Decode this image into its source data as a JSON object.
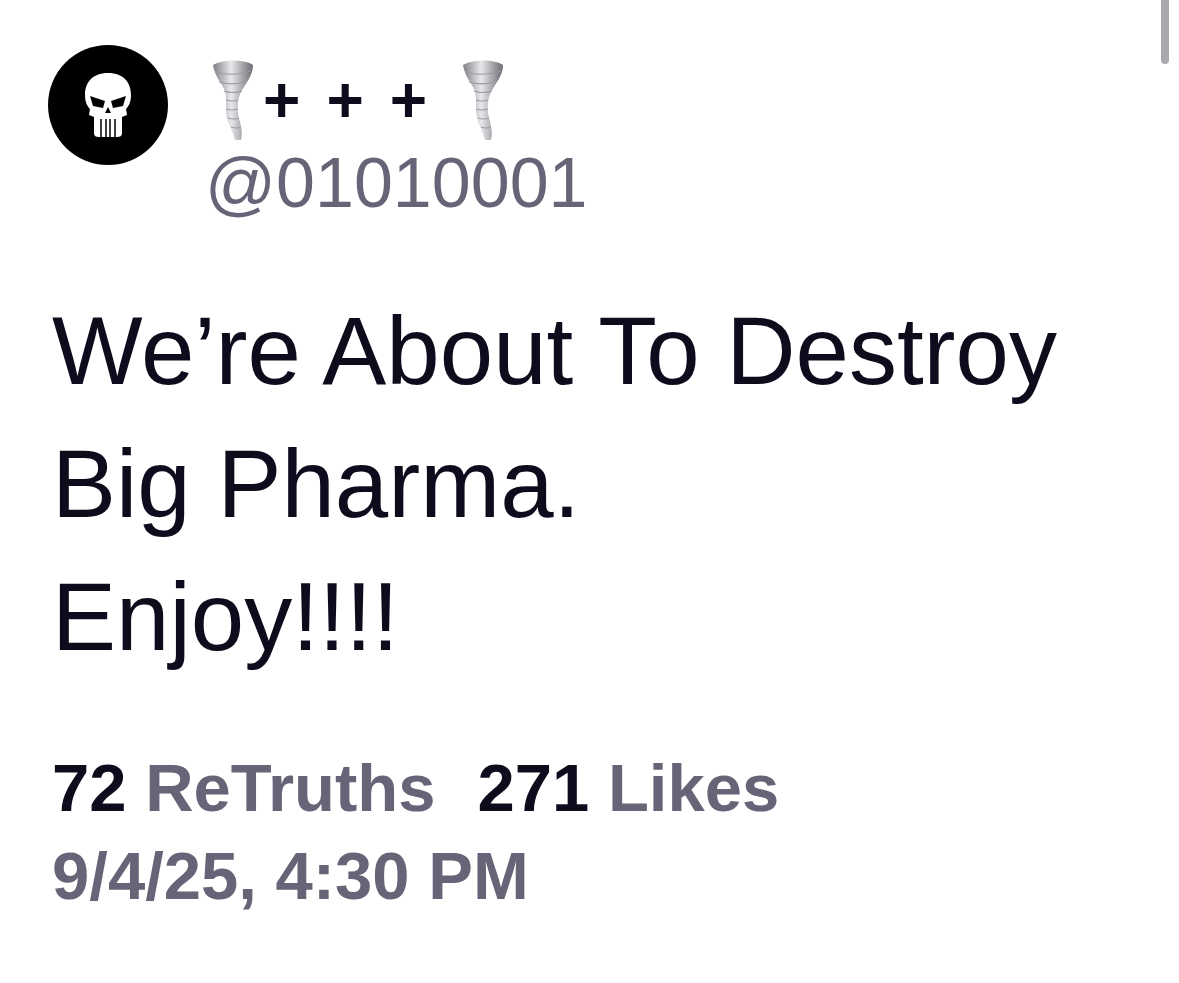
{
  "post": {
    "author": {
      "display_name": "+++",
      "handle": "@01010001"
    },
    "text": "We’re About To Destroy Big Pharma.\nEnjoy!!!!",
    "stats": [
      {
        "count": "72",
        "label": "ReTruths"
      },
      {
        "count": "271",
        "label": "Likes"
      }
    ],
    "timestamp": "9/4/25, 4:30 PM"
  }
}
